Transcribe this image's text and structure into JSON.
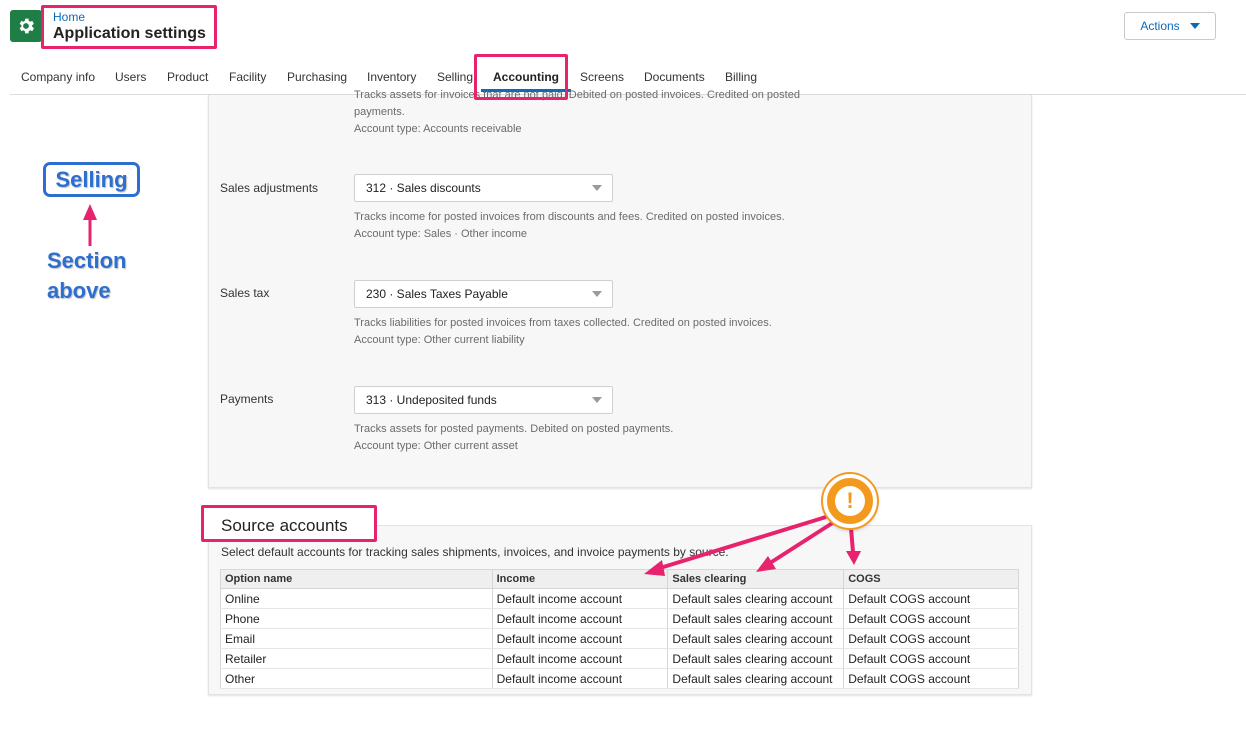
{
  "header": {
    "breadcrumb": "Home",
    "title": "Application settings",
    "actions_label": "Actions",
    "app_icon": "gear-icon",
    "brand_color": "#1e7e46"
  },
  "tabs": [
    {
      "label": "Company info",
      "active": false
    },
    {
      "label": "Users",
      "active": false
    },
    {
      "label": "Product",
      "active": false
    },
    {
      "label": "Facility",
      "active": false
    },
    {
      "label": "Purchasing",
      "active": false
    },
    {
      "label": "Inventory",
      "active": false
    },
    {
      "label": "Selling",
      "active": false
    },
    {
      "label": "Accounting",
      "active": true
    },
    {
      "label": "Screens",
      "active": false
    },
    {
      "label": "Documents",
      "active": false
    },
    {
      "label": "Billing",
      "active": false
    }
  ],
  "selling": {
    "top_help_line1": "Tracks assets for invoices that are not paid. Debited on posted invoices. Credited on posted",
    "top_help_line2": "payments.",
    "top_help_line3": "Account type: Accounts receivable",
    "rows": [
      {
        "label": "Sales adjustments",
        "value": "312 · Sales discounts",
        "help": "Tracks income for posted invoices from discounts and fees. Credited on posted invoices.",
        "type": "Account type: Sales · Other income"
      },
      {
        "label": "Sales tax",
        "value": "230 · Sales Taxes Payable",
        "help": "Tracks liabilities for posted invoices from taxes collected. Credited on posted invoices.",
        "type": "Account type: Other current liability"
      },
      {
        "label": "Payments",
        "value": "313 · Undeposited funds",
        "help": "Tracks assets for posted payments. Debited on posted payments.",
        "type": "Account type: Other current asset"
      }
    ]
  },
  "source_accounts": {
    "title": "Source accounts",
    "description": "Select default accounts for tracking sales shipments, invoices, and invoice payments by source.",
    "columns": [
      "Option name",
      "Income",
      "Sales clearing",
      "COGS"
    ],
    "rows": [
      [
        "Online",
        "Default income account",
        "Default sales clearing account",
        "Default COGS account"
      ],
      [
        "Phone",
        "Default income account",
        "Default sales clearing account",
        "Default COGS account"
      ],
      [
        "Email",
        "Default income account",
        "Default sales clearing account",
        "Default COGS account"
      ],
      [
        "Retailer",
        "Default income account",
        "Default sales clearing account",
        "Default COGS account"
      ],
      [
        "Other",
        "Default income account",
        "Default sales clearing account",
        "Default COGS account"
      ]
    ]
  },
  "annotations": {
    "selling_label": "Selling",
    "section_line1": "Section",
    "section_line2": "above",
    "warning_symbol": "!",
    "highlight_color": "#e8236d",
    "callout_color": "#2c6fd1",
    "warning_color": "#f39a1e"
  }
}
